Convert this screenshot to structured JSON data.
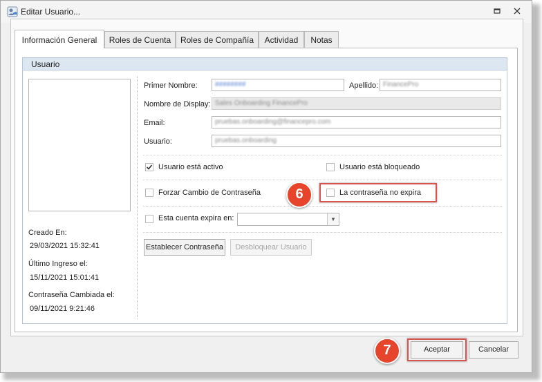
{
  "window": {
    "title": "Editar Usuario...",
    "controls": {
      "restore_icon": "restore-icon",
      "close_icon": "close-icon"
    }
  },
  "tabs": [
    {
      "label": "Información General",
      "active": true
    },
    {
      "label": "Roles de Cuenta",
      "active": false
    },
    {
      "label": "Roles de Compañía",
      "active": false
    },
    {
      "label": "Actividad",
      "active": false
    },
    {
      "label": "Notas",
      "active": false
    }
  ],
  "group": {
    "title": "Usuario"
  },
  "info": {
    "created_label": "Creado En:",
    "created_value": "29/03/2021 15:32:41",
    "last_login_label": "Último Ingreso el:",
    "last_login_value": "15/11/2021 15:01:41",
    "pwd_changed_label": "Contraseña Cambiada el:",
    "pwd_changed_value": "09/11/2021 9:21:46"
  },
  "form": {
    "first_name_label": "Primer Nombre:",
    "first_name_value": "########",
    "last_name_label": "Apellido:",
    "last_name_value": "FinancePro",
    "display_label": "Nombre de Display:",
    "display_value": "Sales Onboarding FinancePro",
    "email_label": "Email:",
    "email_value": "pruebas.onboarding@financepro.com",
    "user_label": "Usuario:",
    "user_value": "pruebas.onboarding"
  },
  "checks": {
    "active": {
      "label": "Usuario está activo",
      "checked": true
    },
    "locked": {
      "label": "Usuario está bloqueado",
      "checked": false
    },
    "force_change": {
      "label": "Forzar Cambio de Contraseña",
      "checked": false
    },
    "no_expire": {
      "label": "La contraseña no expira",
      "checked": false
    },
    "account_expires": {
      "label": "Esta cuenta expira en:",
      "checked": false
    }
  },
  "combo": {
    "value": ""
  },
  "buttons": {
    "set_password": "Establecer Contraseña",
    "unlock_user": "Desbloquear Usuario",
    "accept": "Aceptar",
    "cancel": "Cancelar"
  },
  "annotations": {
    "marker6": "6",
    "marker7": "7",
    "color": "#e6452b"
  }
}
